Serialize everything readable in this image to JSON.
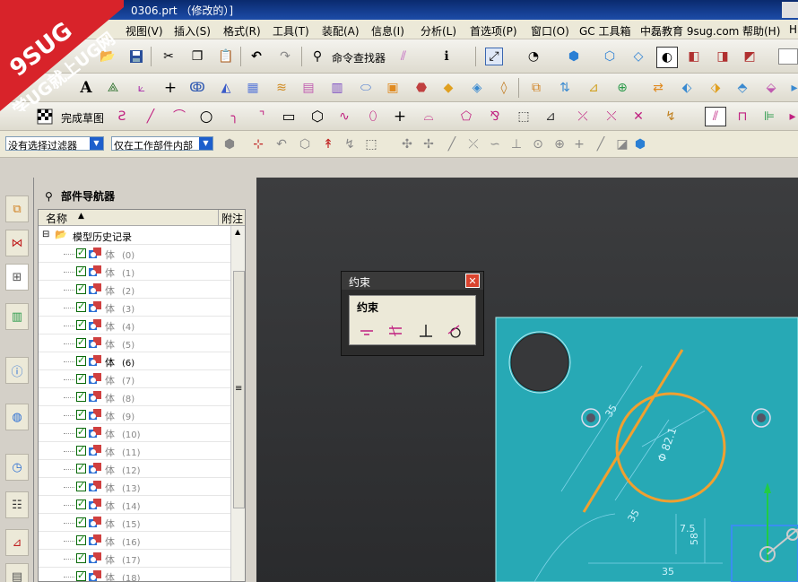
{
  "title_bar": {
    "text": "0306.prt （修改的）]"
  },
  "menu": {
    "items": [
      "视图(V)",
      "插入(S)",
      "格式(R)",
      "工具(T)",
      "装配(A)",
      "信息(I)",
      "分析(L)",
      "首选项(P)",
      "窗口(O)",
      "GC 工具箱",
      "中磊教育 9sug.com",
      "帮助(H)",
      "H"
    ]
  },
  "logo": {
    "brand": "9SUG",
    "slogan": "学UG就上UG网"
  },
  "toolbar1": {
    "find_command": "命令查找器"
  },
  "toolbar3": {
    "finish_sketch": "完成草图"
  },
  "selection_bar": {
    "filter_value": "没有选择过滤器",
    "scope_value": "仅在工作部件内部"
  },
  "navigator": {
    "title": "部件导航器",
    "col_name": "名称",
    "col_attach": "附注",
    "root": "模型历史记录",
    "rows": [
      {
        "name": "体",
        "idx": "(0)"
      },
      {
        "name": "体",
        "idx": "(1)"
      },
      {
        "name": "体",
        "idx": "(2)"
      },
      {
        "name": "体",
        "idx": "(3)"
      },
      {
        "name": "体",
        "idx": "(4)"
      },
      {
        "name": "体",
        "idx": "(5)"
      },
      {
        "name": "体",
        "idx": "(6)"
      },
      {
        "name": "体",
        "idx": "(7)"
      },
      {
        "name": "体",
        "idx": "(8)"
      },
      {
        "name": "体",
        "idx": "(9)"
      },
      {
        "name": "体",
        "idx": "(10)"
      },
      {
        "name": "体",
        "idx": "(11)"
      },
      {
        "name": "体",
        "idx": "(12)"
      },
      {
        "name": "体",
        "idx": "(13)"
      },
      {
        "name": "体",
        "idx": "(14)"
      },
      {
        "name": "体",
        "idx": "(15)"
      },
      {
        "name": "体",
        "idx": "(16)"
      },
      {
        "name": "体",
        "idx": "(17)"
      },
      {
        "name": "体",
        "idx": "(18)"
      }
    ],
    "active_row": 6
  },
  "constraint_dialog": {
    "title": "约束",
    "group": "约束"
  },
  "sketch": {
    "dim_diameter": "Φ 82.1",
    "dim_a": "35",
    "dim_b": "35",
    "dim_c": "7.5",
    "dim_d": "58",
    "dim_e": "35"
  },
  "colors": {
    "part_face": "#27a9b5",
    "sketch_curve": "#f0a030",
    "dim_line": "#7fd3e8",
    "background_top": "#3c3d3f"
  }
}
